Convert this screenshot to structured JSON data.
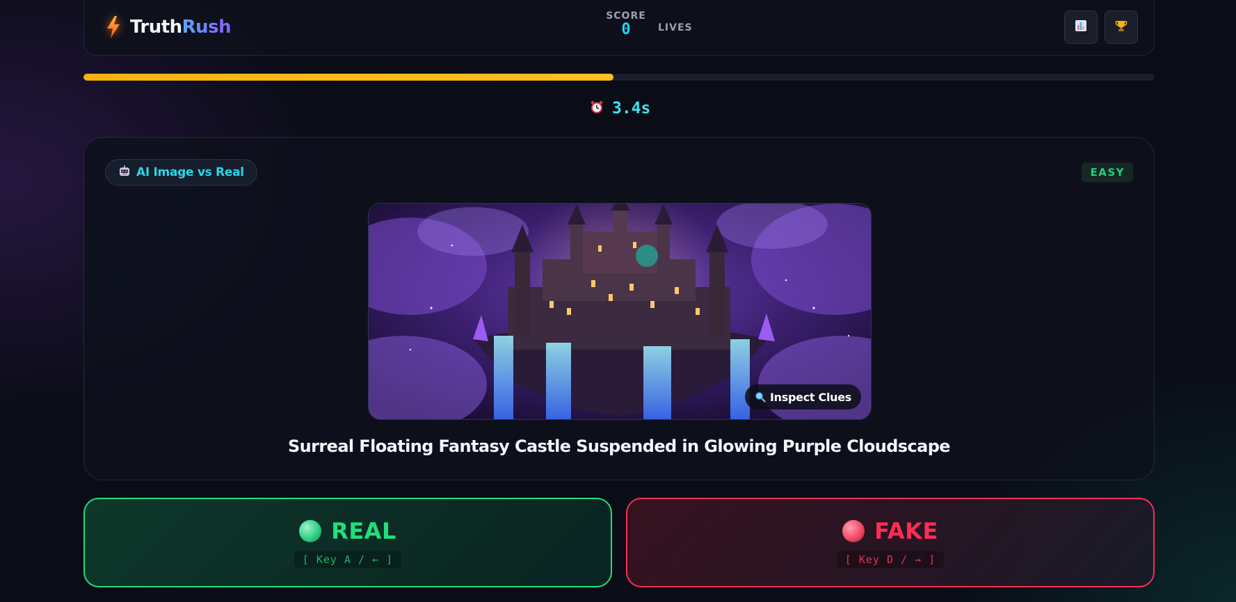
{
  "header": {
    "brand_part1": "Truth",
    "brand_part2": "Rush",
    "score_label": "SCORE",
    "score_value": "0",
    "lives_label": "LIVES",
    "icons": {
      "logo": "lightning-bolt-icon",
      "stats": "bar-chart-icon",
      "leaderboard": "trophy-icon"
    }
  },
  "progress": {
    "fraction": 0.495,
    "color": "#f8b20f"
  },
  "timer": {
    "icon": "alarm-clock-icon",
    "value": "3.4s"
  },
  "card": {
    "category_icon": "robot-icon",
    "category_label": "AI Image vs Real",
    "difficulty": "EASY",
    "image_subject": "floating fantasy castle in purple cloudscape",
    "inspect_icon": "magnifier-icon",
    "inspect_label": "Inspect Clues",
    "headline": "Surreal Floating Fantasy Castle Suspended in Glowing Purple Cloudscape"
  },
  "answers": {
    "real": {
      "label": "REAL",
      "key_hint": "[ Key A / ← ]",
      "color": "#1fe07d"
    },
    "fake": {
      "label": "FAKE",
      "key_hint": "[ Key D / → ]",
      "color": "#ff2c55"
    }
  }
}
